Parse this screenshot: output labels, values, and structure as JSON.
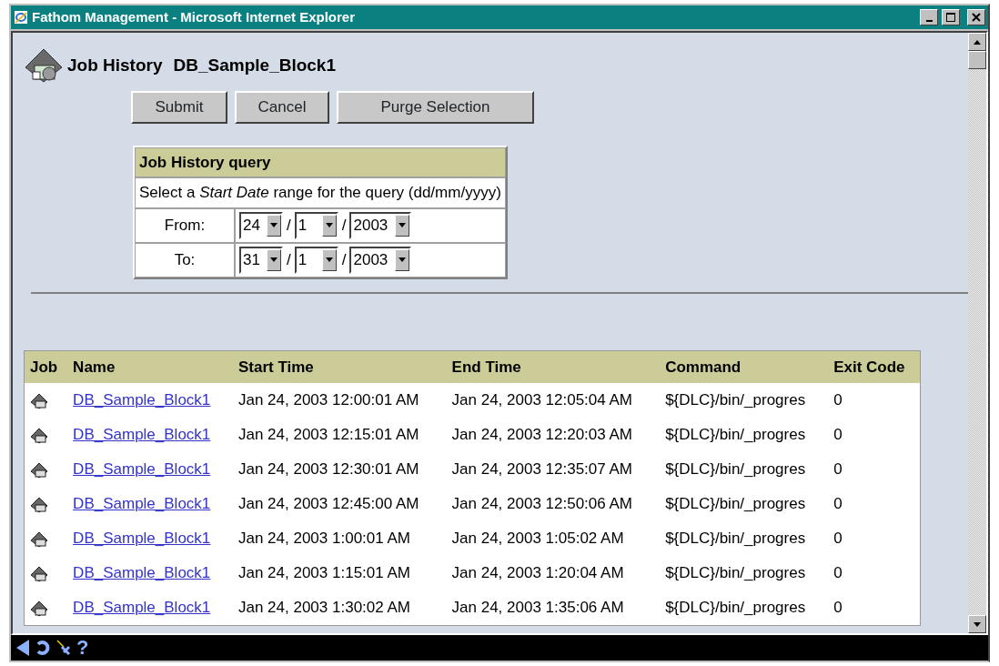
{
  "window": {
    "title": "Fathom Management - Microsoft Internet Explorer"
  },
  "heading": {
    "label": "Job History",
    "name": "DB_Sample_Block1"
  },
  "buttons": [
    "Submit",
    "Cancel",
    "Purge Selection"
  ],
  "query": {
    "title": "Job History query",
    "hint": "Select a *Start Date* range for the query (dd/mm/yyyy)",
    "separator": "/",
    "ranges": [
      {
        "label": "From:",
        "day": "24",
        "month": "1",
        "year": "2003"
      },
      {
        "label": "To:",
        "day": "31",
        "month": "1",
        "year": "2003"
      }
    ]
  },
  "table": {
    "columns": [
      "Job",
      "Name",
      "Start Time",
      "End Time",
      "Command",
      "Exit Code"
    ],
    "rows": [
      {
        "name": "DB_Sample_Block1",
        "start": "Jan 24, 2003 12:00:01 AM",
        "end": "Jan 24, 2003 12:05:04 AM",
        "command": "${DLC}/bin/_progres",
        "exit": "0"
      },
      {
        "name": "DB_Sample_Block1",
        "start": "Jan 24, 2003 12:15:01 AM",
        "end": "Jan 24, 2003 12:20:03 AM",
        "command": "${DLC}/bin/_progres",
        "exit": "0"
      },
      {
        "name": "DB_Sample_Block1",
        "start": "Jan 24, 2003 12:30:01 AM",
        "end": "Jan 24, 2003 12:35:07 AM",
        "command": "${DLC}/bin/_progres",
        "exit": "0"
      },
      {
        "name": "DB_Sample_Block1",
        "start": "Jan 24, 2003 12:45:00 AM",
        "end": "Jan 24, 2003 12:50:06 AM",
        "command": "${DLC}/bin/_progres",
        "exit": "0"
      },
      {
        "name": "DB_Sample_Block1",
        "start": "Jan 24, 2003 1:00:01 AM",
        "end": "Jan 24, 2003 1:05:02 AM",
        "command": "${DLC}/bin/_progres",
        "exit": "0"
      },
      {
        "name": "DB_Sample_Block1",
        "start": "Jan 24, 2003 1:15:01 AM",
        "end": "Jan 24, 2003 1:20:04 AM",
        "command": "${DLC}/bin/_progres",
        "exit": "0"
      },
      {
        "name": "DB_Sample_Block1",
        "start": "Jan 24, 2003 1:30:02 AM",
        "end": "Jan 24, 2003 1:35:06 AM",
        "command": "${DLC}/bin/_progres",
        "exit": "0"
      }
    ]
  },
  "footer": {
    "help": "?"
  }
}
